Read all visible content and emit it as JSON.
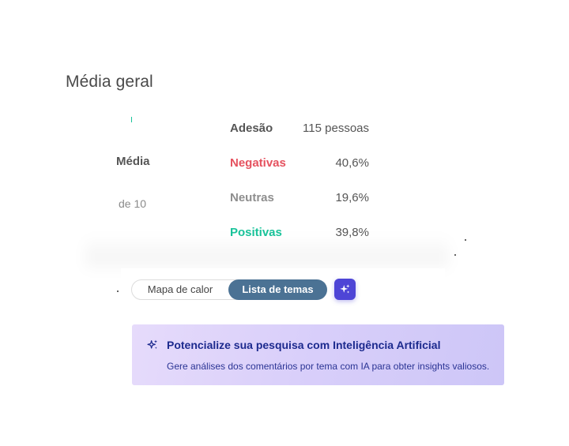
{
  "section": {
    "title": "Média geral"
  },
  "score": {
    "label": "Média",
    "scale": "de 10"
  },
  "stats": [
    {
      "name": "Adesão",
      "value": "115 pessoas",
      "color": "#555555"
    },
    {
      "name": "Negativas",
      "value": "40,6%",
      "color": "#e5525f"
    },
    {
      "name": "Neutras",
      "value": "19,6%",
      "color": "#8e8e8e"
    },
    {
      "name": "Positivas",
      "value": "39,8%",
      "color": "#19c39a"
    }
  ],
  "toggle": {
    "options": [
      "Mapa de calor",
      "Lista de temas"
    ],
    "selected": "Lista de temas",
    "active_color": "#4b7294"
  },
  "ai_button": {
    "icon": "sparkles-icon",
    "color": "#4e45d6"
  },
  "ai_banner": {
    "icon": "sparkles-icon",
    "title": "Potencialize sua pesquisa com Inteligência Artificial",
    "text": "Gere análises dos comentários por tema com IA para obter insights valiosos."
  }
}
